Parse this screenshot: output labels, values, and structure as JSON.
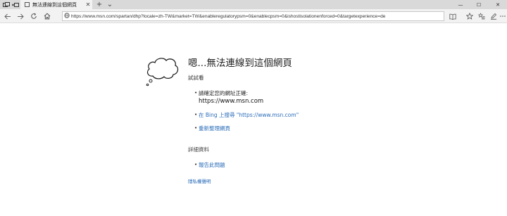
{
  "tab": {
    "title": "無法連線到這個網頁",
    "close_glyph": "✕",
    "new_tab_glyph": "+",
    "more_glyph": "⌄"
  },
  "window_controls": {
    "minimize": "—",
    "maximize": "☐",
    "close": "✕"
  },
  "address_bar": {
    "url": "https://www.msn.com/spartan/dhp?locale=zh-TW&market=TW&enableregulatorypsm=0&enablecpsm=0&ishostisolationenforced=0&targetexperience=de"
  },
  "icons": {
    "tab_manager": "tabs-icon",
    "tab_back": "tab-back-icon",
    "back": "back-arrow-icon",
    "forward": "forward-arrow-icon",
    "refresh": "refresh-icon",
    "home": "home-icon",
    "site_info": "globe-icon",
    "reading_view": "book-icon",
    "favorite": "star-icon",
    "favorites_hub": "favorites-list-icon",
    "notes": "pen-icon",
    "share": "share-icon",
    "more": "more-icon",
    "error": "thought-cloud-icon"
  },
  "error_page": {
    "title": "嗯...無法連線到這個網頁",
    "try_label": "試試看",
    "suggestions": {
      "check_address": "請確定您的網址正確:",
      "address": "https://www.msn.com",
      "search_bing": "在 Bing 上搜尋 \"https://www.msn.com\"",
      "refresh": "重新整理網頁"
    },
    "details_label": "詳細資料",
    "report": "報告此問題",
    "privacy": "隱私權聲明"
  }
}
